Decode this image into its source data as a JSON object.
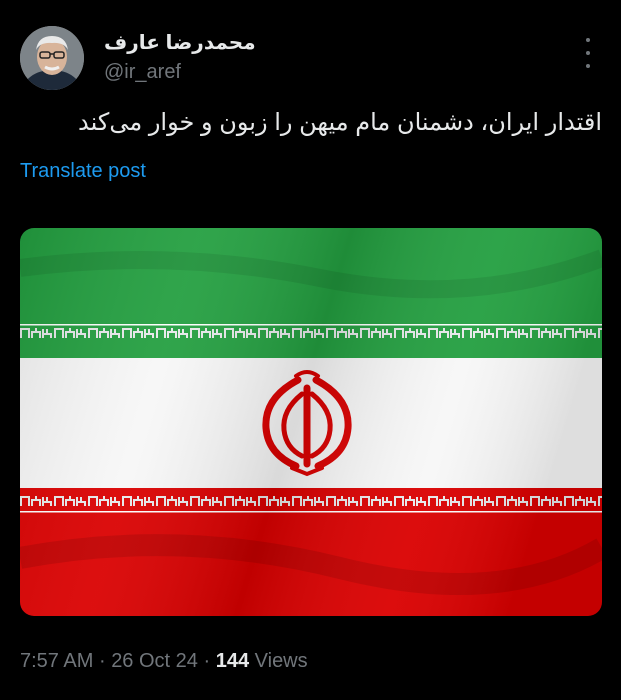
{
  "author": {
    "name": "محمدرضا عارف",
    "handle": "@ir_aref"
  },
  "post": {
    "text": "اقتدار ایران، دشمنان مام میهن را زبون و خوار می‌کند",
    "translate_label": "Translate post"
  },
  "media": {
    "description_icon": "iran-flag",
    "colors": {
      "green": "#239f40",
      "white": "#ffffff",
      "red": "#da0000"
    }
  },
  "meta": {
    "time": "7:57 AM",
    "separator": "·",
    "date": "26 Oct 24",
    "views_count": "144",
    "views_label": "Views"
  },
  "icons": {
    "more": "more-dots-icon"
  }
}
